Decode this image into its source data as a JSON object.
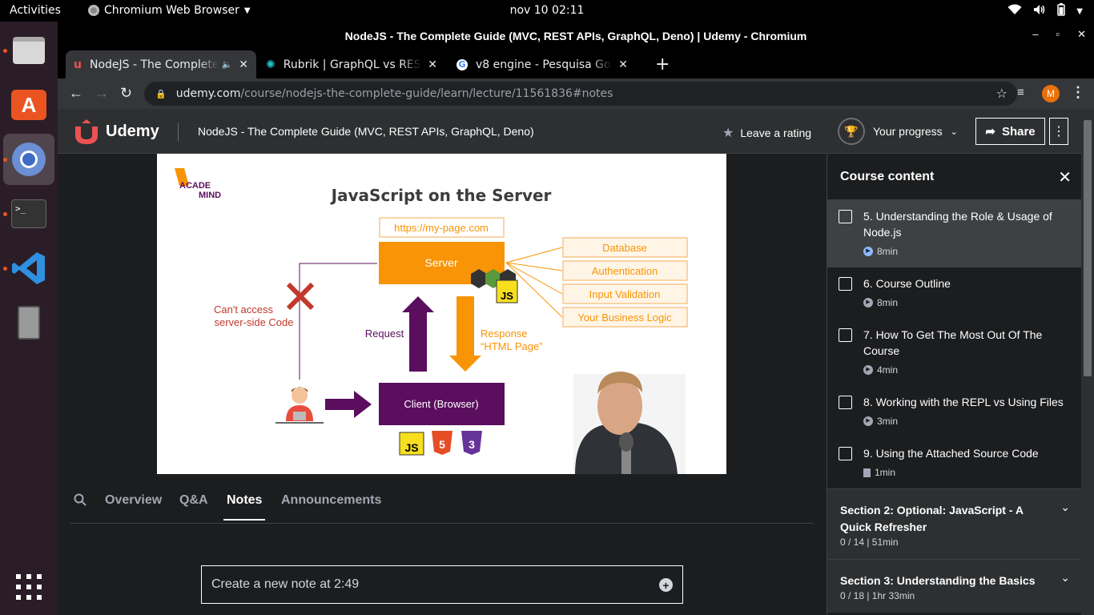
{
  "topbar": {
    "activities": "Activities",
    "app_name": "Chromium Web Browser",
    "clock": "nov 10  02:11"
  },
  "dock": {
    "items": [
      "files-icon",
      "software-icon",
      "chromium-icon",
      "terminal-icon",
      "vscode-icon",
      "device-icon",
      "app-grid-icon"
    ]
  },
  "window": {
    "title": "NodeJS - The Complete Guide (MVC, REST APIs, GraphQL, Deno) | Udemy - Chromium"
  },
  "tabs": [
    {
      "title": "NodeJS - The Complete Guide (MVC, REST APIs, GraphQL, Deno) | Udemy",
      "active": true
    },
    {
      "title": "Rubrik | GraphQL vs REST APIs",
      "active": false
    },
    {
      "title": "v8 engine - Pesquisa Google",
      "active": false
    }
  ],
  "omnibox": {
    "host": "udemy.com",
    "path": "/course/nodejs-the-complete-guide/learn/lecture/11561836#notes",
    "avatar": "M"
  },
  "udemy": {
    "brand": "Udemy",
    "course_title": "NodeJS - The Complete Guide (MVC, REST APIs, GraphQL, Deno)",
    "rating_label": "Leave a rating",
    "progress_label": "Your progress",
    "share_label": "Share"
  },
  "slide": {
    "logo_top": "ACADE",
    "logo_bottom": "MIND",
    "title": "JavaScript on the Server",
    "url": "https://my-page.com",
    "server": "Server",
    "client": "Client (Browser)",
    "request": "Request",
    "response_1": "Response",
    "response_2": "“HTML Page”",
    "no_access_1": "Can't access",
    "no_access_2": "server-side Code",
    "services": [
      "Database",
      "Authentication",
      "Input Validation",
      "Your Business Logic"
    ],
    "js_badge": "JS",
    "html_badge": "5",
    "css_badge": "3"
  },
  "lecture_tabs": {
    "overview": "Overview",
    "qa": "Q&A",
    "notes": "Notes",
    "announcements": "Announcements"
  },
  "note": {
    "placeholder": "Create a new note at 2:49"
  },
  "sidebar": {
    "title": "Course content",
    "lectures": [
      {
        "title": "5. Understanding the Role & Usage of Node.js",
        "duration": "8min",
        "type": "video",
        "current": true
      },
      {
        "title": "6. Course Outline",
        "duration": "8min",
        "type": "video",
        "current": false
      },
      {
        "title": "7. How To Get The Most Out Of The Course",
        "duration": "4min",
        "type": "video",
        "current": false
      },
      {
        "title": "8. Working with the REPL vs Using Files",
        "duration": "3min",
        "type": "video",
        "current": false
      },
      {
        "title": "9. Using the Attached Source Code",
        "duration": "1min",
        "type": "file",
        "current": false
      }
    ],
    "sections": [
      {
        "title": "Section 2: Optional: JavaScript - A Quick Refresher",
        "meta": "0 / 14 | 51min"
      },
      {
        "title": "Section 3: Understanding the Basics",
        "meta": "0 / 18 | 1hr 33min"
      }
    ]
  },
  "colors": {
    "udemy_red": "#a435f0",
    "slide_orange": "#f89406",
    "slide_purple": "#5b0e5e"
  }
}
